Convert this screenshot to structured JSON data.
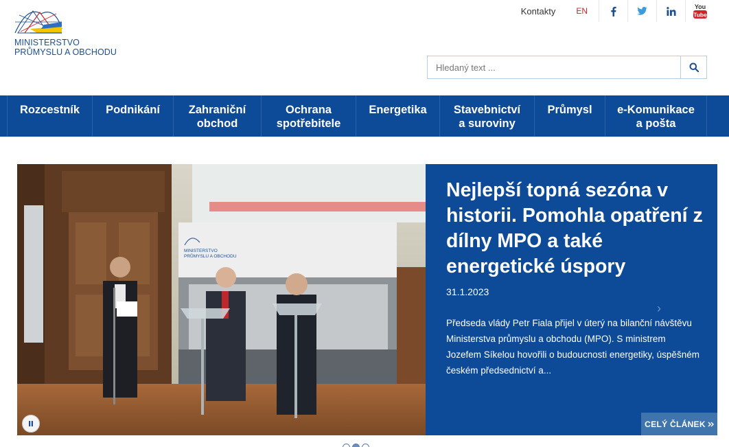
{
  "logo": {
    "line1": "MINISTERSTVO",
    "line2": "PRŮMYSLU A OBCHODU"
  },
  "topbar": {
    "contacts": "Kontakty",
    "lang": "EN",
    "social": [
      "facebook-icon",
      "twitter-icon",
      "linkedin-icon",
      "youtube-icon"
    ],
    "youtube_word_1": "You",
    "youtube_word_2": "Tube"
  },
  "search": {
    "placeholder": "Hledaný text ..."
  },
  "nav": {
    "items": [
      {
        "line1": "Rozcestník",
        "line2": ""
      },
      {
        "line1": "Podnikání",
        "line2": ""
      },
      {
        "line1": "Zahraniční",
        "line2": "obchod"
      },
      {
        "line1": "Ochrana",
        "line2": "spotřebitele"
      },
      {
        "line1": "Energetika",
        "line2": ""
      },
      {
        "line1": "Stavebnictví",
        "line2": "a suroviny"
      },
      {
        "line1": "Průmysl",
        "line2": ""
      },
      {
        "line1": "e-Komunikace",
        "line2": "a pošta"
      }
    ]
  },
  "slide": {
    "headline": "Nejlepší topná sezóna v historii. Pomohla opatření z dílny MPO a také energetické úspory",
    "date": "31.1.2023",
    "perex": "Předseda vlády Petr Fiala přijel v úterý na bilanční návštěvu Ministerstva průmyslu a obchodu (MPO). S ministrem Jozefem Síkelou hovořili o budoucnosti energetiky, úspěšném českém předsednictví a...",
    "more": "CELÝ ČLÁNEK",
    "photo_banner_line1": "MINISTERSTVO",
    "photo_banner_line2": "PRŮMYSLU A OBCHODU"
  },
  "slider_dots": {
    "count": 3,
    "active": 2
  },
  "colors": {
    "brand_blue": "#0d4a97",
    "accent_red": "#c0272d",
    "button_blue": "#3f74ad"
  }
}
